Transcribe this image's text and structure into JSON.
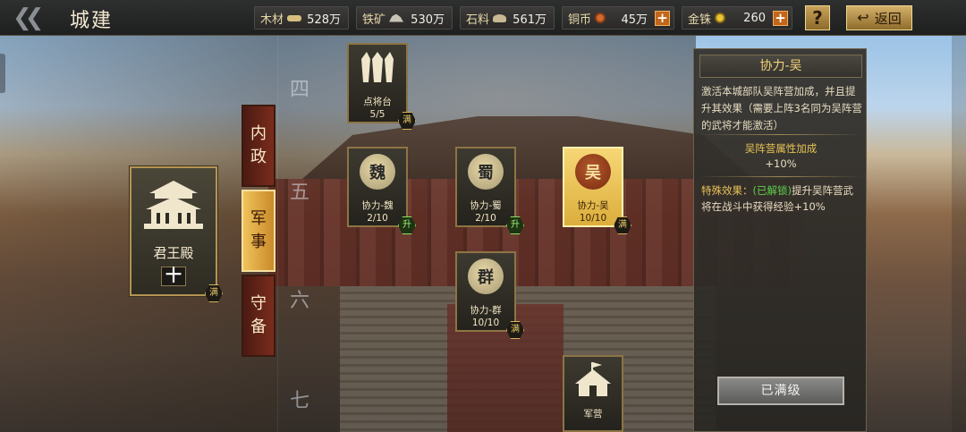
{
  "header": {
    "title": "城建",
    "help_label": "?",
    "return_label": "返回"
  },
  "resources": [
    {
      "label": "木材",
      "value": "528万",
      "icon": "wood-icon"
    },
    {
      "label": "铁矿",
      "value": "530万",
      "icon": "iron-ore-icon"
    },
    {
      "label": "石料",
      "value": "561万",
      "icon": "stone-icon"
    },
    {
      "label": "铜币",
      "value": "45万",
      "icon": "copper-coin-icon"
    },
    {
      "label": "金铢",
      "value": "260",
      "icon": "gold-coin-icon"
    }
  ],
  "building": {
    "name": "君王殿",
    "level": "十",
    "max_badge": "满"
  },
  "tabs": [
    {
      "label": "内\n政",
      "active": false
    },
    {
      "label": "军\n事",
      "active": true
    },
    {
      "label": "守\n备",
      "active": false
    }
  ],
  "tiers": [
    "四",
    "五",
    "六",
    "七"
  ],
  "nodes": [
    {
      "name": "点将台",
      "progress": "5/5",
      "emblem": "generals-icon",
      "badge": "满"
    },
    {
      "name": "协力-魏",
      "progress": "2/10",
      "emblem": "魏",
      "badge": "升"
    },
    {
      "name": "协力-蜀",
      "progress": "2/10",
      "emblem": "蜀",
      "badge": "升"
    },
    {
      "name": "协力-吴",
      "progress": "10/10",
      "emblem": "吴",
      "badge": "满"
    },
    {
      "name": "协力-群",
      "progress": "10/10",
      "emblem": "群",
      "badge": "满"
    },
    {
      "name": "军营",
      "progress": "",
      "emblem": "tent-icon",
      "badge": ""
    }
  ],
  "detail": {
    "title": "协力-吴",
    "description": "激活本城部队吴阵营加成，并且提升其效果（需要上阵3名同为吴阵营的武将才能激活）",
    "bonus_title": "吴阵营属性加成",
    "bonus_value": "+10%",
    "effect_label": "特殊效果：",
    "effect_status": "(已解锁)",
    "effect_text": "提升吴阵营武将在战斗中获得经验+10%",
    "button_label": "已满级"
  },
  "colors": {
    "accent_gold": "#e9c456",
    "unlocked_green": "#5cd04a",
    "tab_active": "#f1c35b",
    "plus_orange": "#c2661b"
  }
}
